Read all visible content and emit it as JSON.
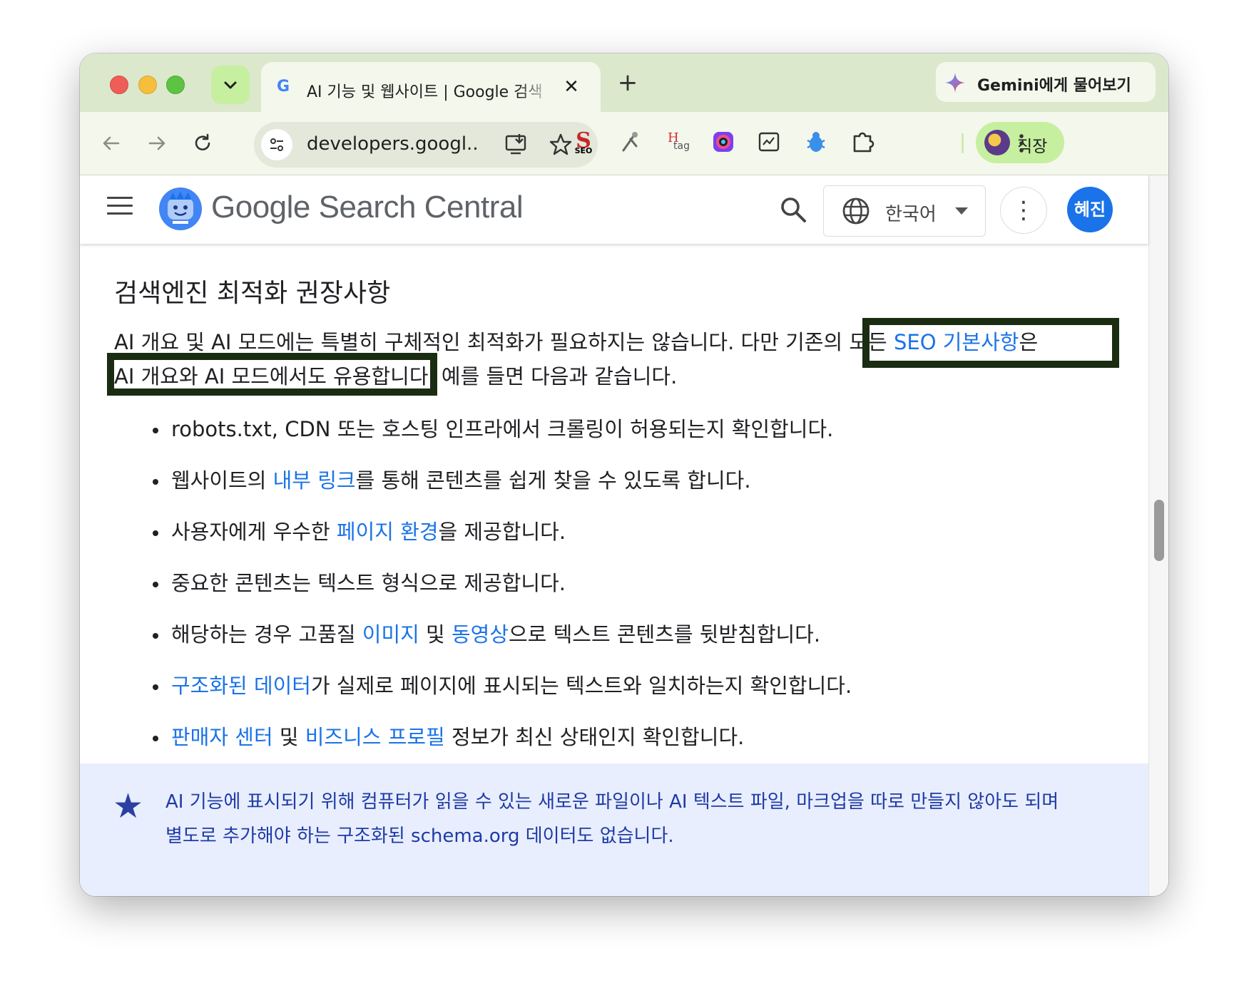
{
  "browser": {
    "tab_title": "AI 기능 및 웹사이트 | Google 검색",
    "tab_close": "✕",
    "new_tab": "+",
    "gemini_label": "Gemini에게 물어보기",
    "url": "developers.googl...",
    "profile_label": "직장",
    "extensions": [
      "seo-extension-icon",
      "eyedropper-icon",
      "htag-extension-icon",
      "camera-extension-icon",
      "page-scan-extension-icon",
      "bug-extension-icon",
      "extensions-puzzle-icon"
    ],
    "ext_htag_text": "H",
    "ext_htag_sub": "tag",
    "ext_seo_text": "SEO"
  },
  "site": {
    "logo_google": "Google",
    "logo_rest": " Search Central",
    "language": "한국어",
    "user_initials": "혜진",
    "more": "⋮"
  },
  "article": {
    "heading": "검색엔진 최적화 권장사항",
    "para": {
      "line1_a": "AI 개요 및 AI 모드에는 특별히 구체적인 최적화가 필요하지는 않습니다. 다만 기존의 모든 ",
      "line1_link": "SEO 기본사항",
      "line1_b": "은",
      "line2": "AI 개요와 AI 모드에서도 유용합니다. 예를 들면 다음과 같습니다."
    },
    "bullets": {
      "b1": "robots.txt, CDN 또는 호스팅 인프라에서 크롤링이 허용되는지 확인합니다.",
      "b2_a": "웹사이트의 ",
      "b2_link": "내부 링크",
      "b2_b": "를 통해 콘텐츠를 쉽게 찾을 수 있도록 합니다.",
      "b3_a": "사용자에게 우수한 ",
      "b3_link": "페이지 환경",
      "b3_b": "을 제공합니다.",
      "b4": "중요한 콘텐츠는 텍스트 형식으로 제공합니다.",
      "b5_a": "해당하는 경우 고품질 ",
      "b5_link1": "이미지",
      "b5_mid": " 및 ",
      "b5_link2": "동영상",
      "b5_b": "으로 텍스트 콘텐츠를 뒷받침합니다.",
      "b6_link": "구조화된 데이터",
      "b6_b": "가 실제로 페이지에 표시되는 텍스트와 일치하는지 확인합니다.",
      "b7_link1": "판매자 센터",
      "b7_mid": " 및 ",
      "b7_link2": "비즈니스 프로필",
      "b7_b": " 정보가 최신 상태인지 확인합니다."
    },
    "note": {
      "icon": "★",
      "line1": "AI 기능에 표시되기 위해 컴퓨터가 읽을 수 있는 새로운 파일이나 AI 텍스트 파일, 마크업을 따로 만들지 않아도 되며",
      "line2": "별도로 추가해야 하는 구조화된 schema.org 데이터도 없습니다."
    }
  },
  "colors": {
    "tabstrip": "#dbe8cc",
    "toolbar": "#f4f7ec",
    "link": "#1a73e8",
    "highlight_border": "#1a2c12",
    "note_bg": "#e8eefd",
    "note_text": "#1f3aa6",
    "avatar": "#1a73e8"
  }
}
